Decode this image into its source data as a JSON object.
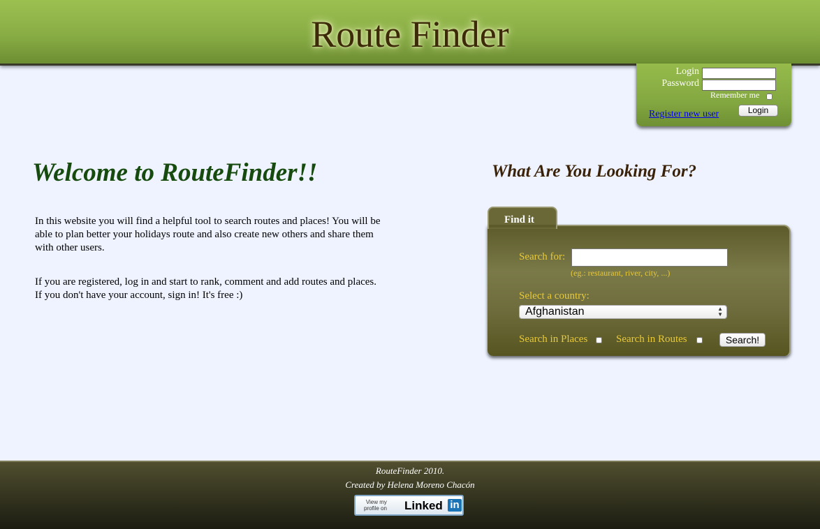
{
  "header": {
    "title": "Route Finder"
  },
  "login": {
    "login_label": "Login",
    "password_label": "Password",
    "remember_label": "Remember me",
    "register_link": "Register new user",
    "login_button": "Login"
  },
  "welcome": {
    "title": "Welcome to RouteFinder!!",
    "paragraph1": "In this website you will find a helpful tool to search routes and places! You will be able to plan better your holidays route and also create new others and share them with other users.",
    "paragraph2": "If you are registered, log in and start to rank, comment and add routes and places. If you don't have your account, sign in! It's free :)"
  },
  "search": {
    "heading": "What Are You Looking For?",
    "tab_label": "Find it",
    "search_for_label": "Search for:",
    "search_hint": "(eg.: restaurant, river, city, ...)",
    "country_label": "Select a country:",
    "country_selected": "Afghanistan",
    "places_label": "Search in Places",
    "routes_label": "Search in Routes",
    "search_button": "Search!"
  },
  "footer": {
    "line1": "RouteFinder 2010.",
    "line2": "Created by Helena Moreno Chacón",
    "linkedin_small_1": "View my",
    "linkedin_small_2": "profile on",
    "linkedin_brand": "Linked",
    "linkedin_badge": "in"
  },
  "colors": {
    "header_green": "#89ad45",
    "title_brown": "#3c2a08",
    "welcome_green": "#164a0e",
    "panel_olive": "#6e6c3c",
    "label_gold": "#e8c93a",
    "background": "#eef3ff"
  }
}
